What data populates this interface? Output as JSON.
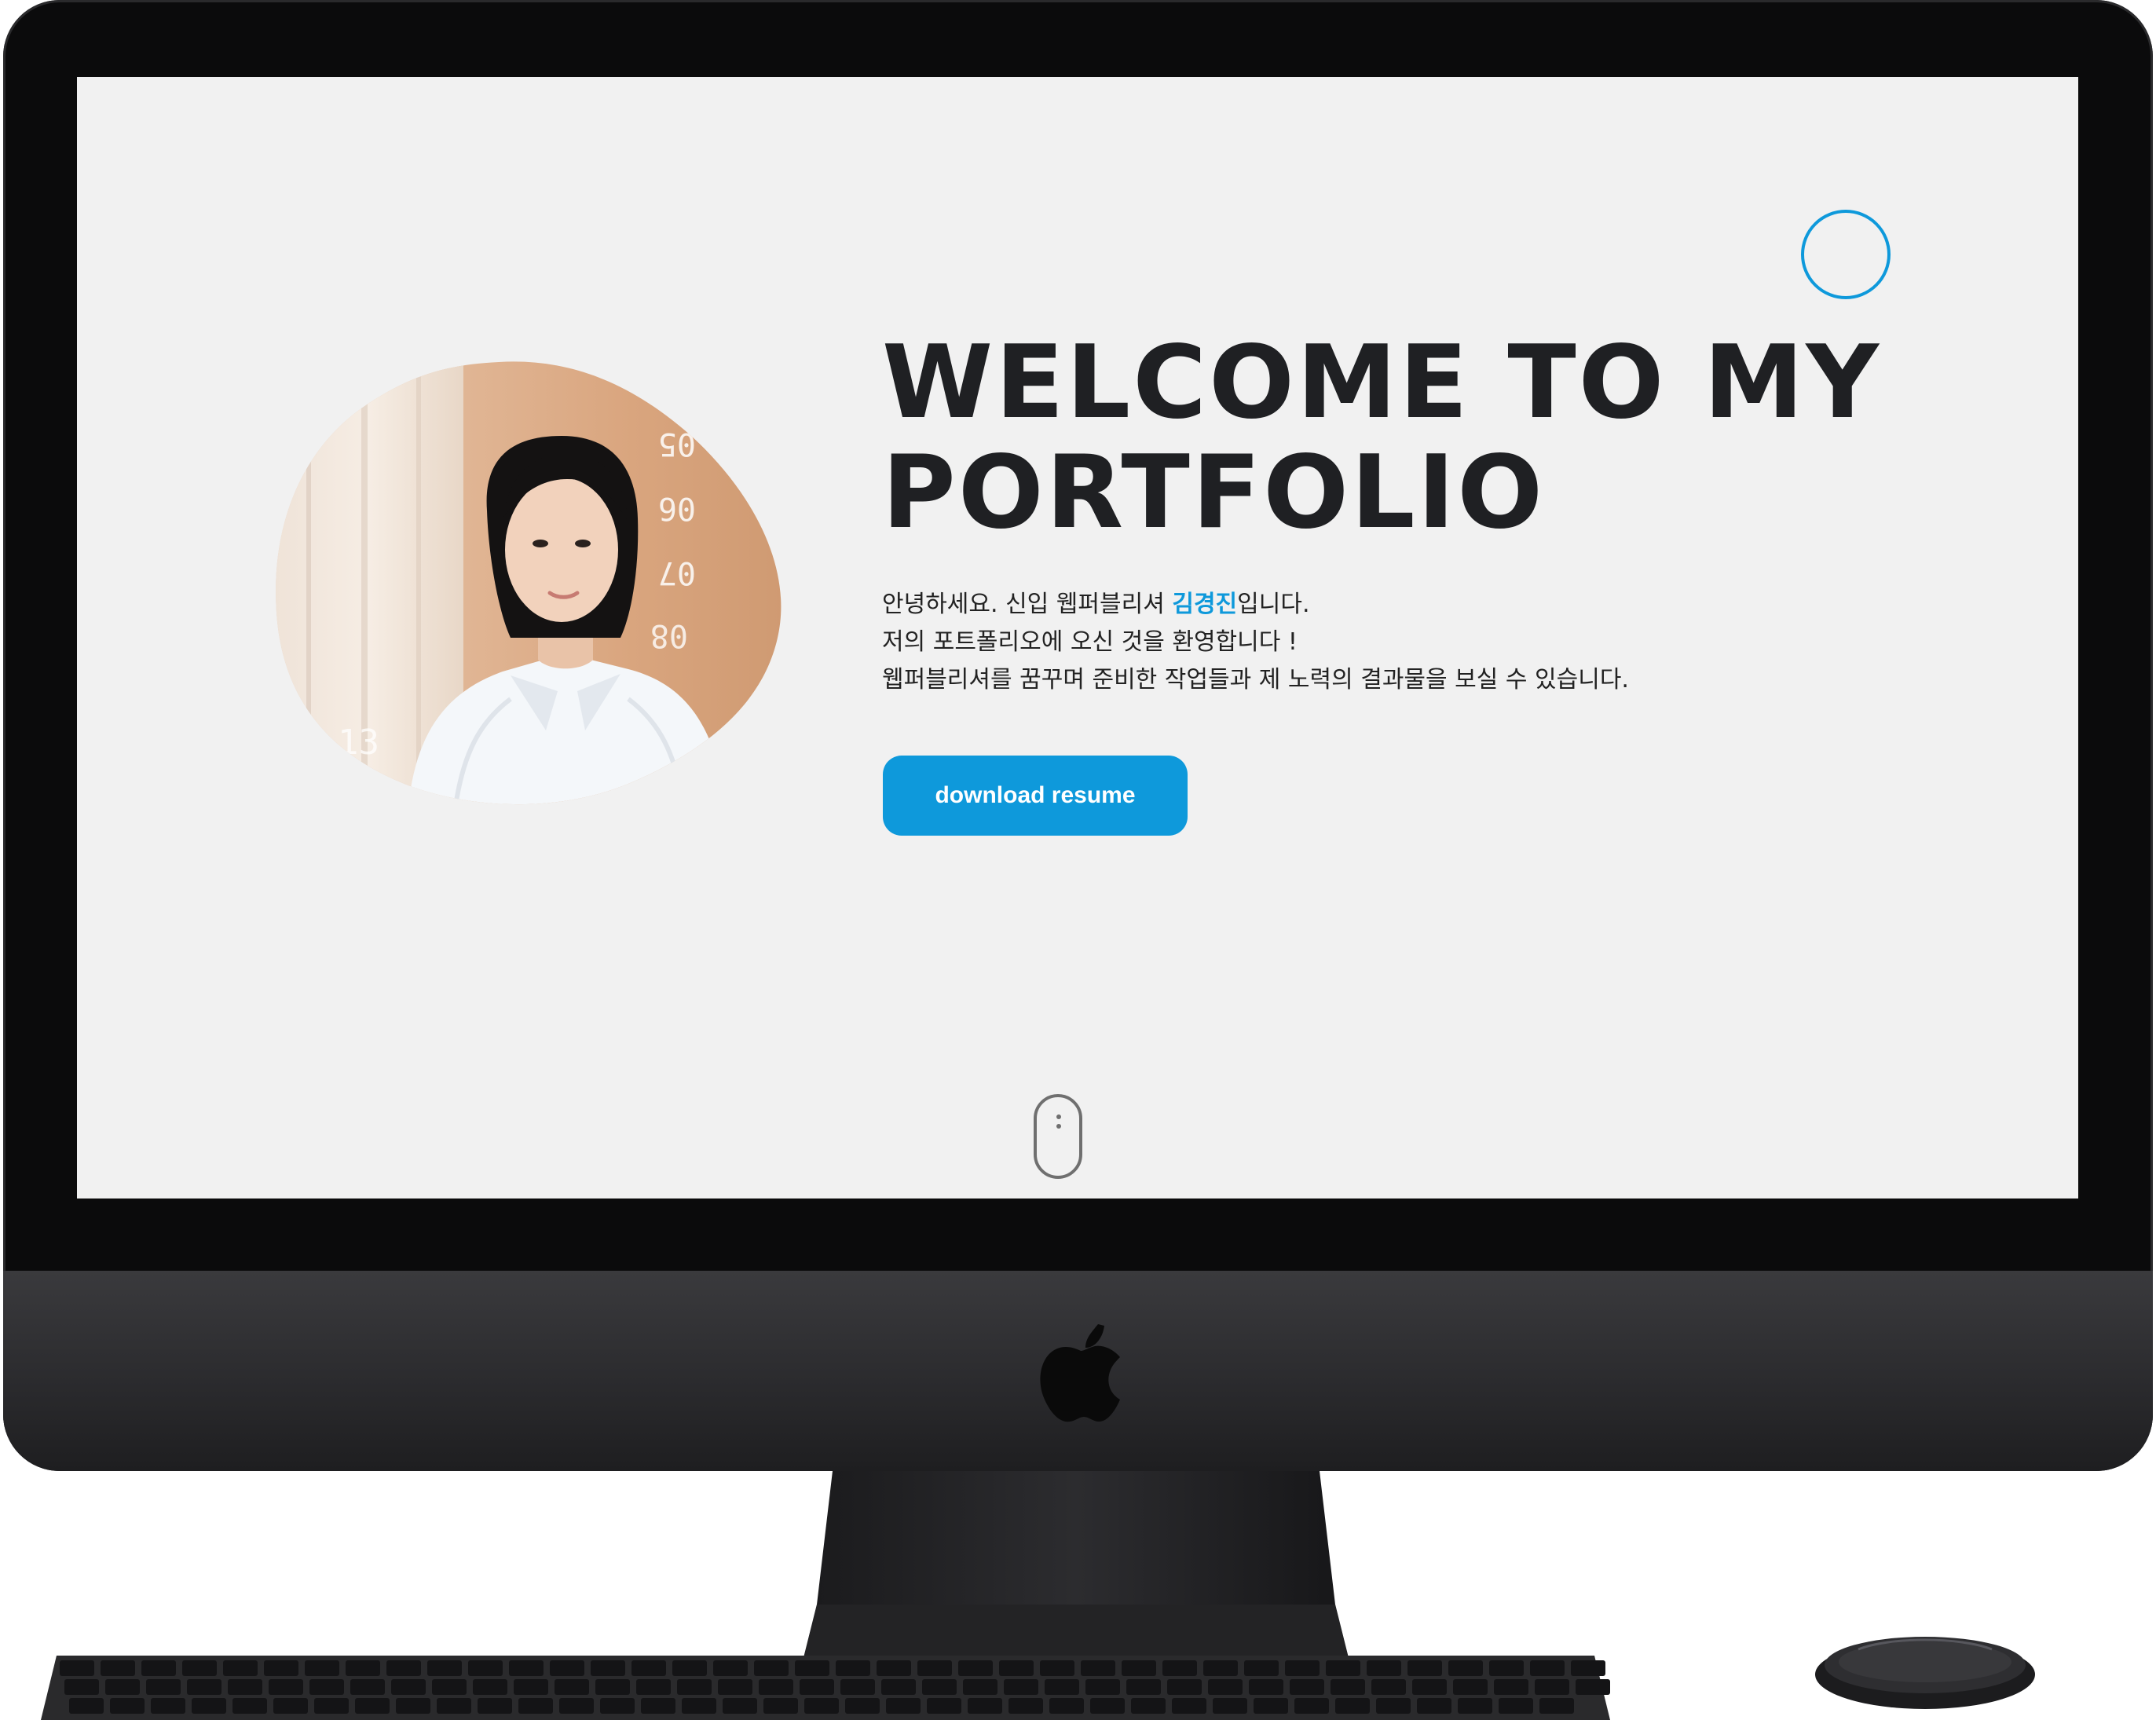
{
  "page": {
    "headline_line1": "WELCOME TO MY",
    "headline_line2": "PORTFOLIO",
    "intro_line1_before": "안녕하세요. 신입 웹퍼블리셔 ",
    "intro_name": "김경진",
    "intro_line1_after": "입니다.",
    "intro_line2": "저의 포트폴리오에 오신 것을 환영합니다 !",
    "intro_line3": "웹퍼블리셔를 꿈꾸며 준비한 작업들과 제 노력의 결과물을 보실 수 있습니다.",
    "download_label": "download resume"
  },
  "photo": {
    "wall_numbers": [
      "05",
      "06",
      "07",
      "08",
      "13"
    ]
  },
  "colors": {
    "accent": "#0e99db",
    "screen_background": "#f1f1f1",
    "headline": "#1f2023",
    "bezel": "#0b0b0c",
    "chin": "#2f2f32"
  },
  "icons": {
    "hardware_logo": "apple-logo-icon",
    "scroll_hint": "scroll-mouse-icon",
    "decoration": "accent-ring"
  }
}
